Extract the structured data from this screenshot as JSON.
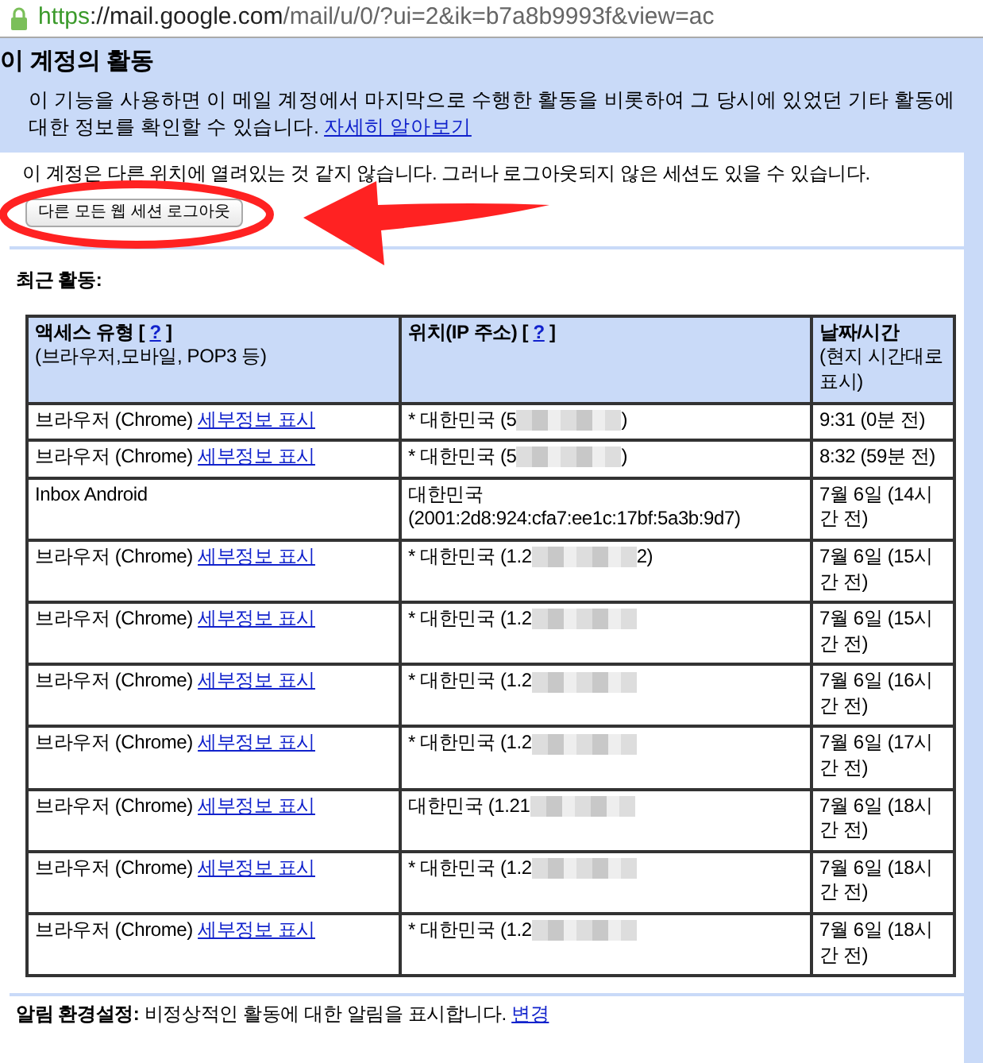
{
  "address_bar": {
    "scheme": "https",
    "host": "://mail.google.com",
    "path": "/mail/u/0/?ui=2&ik=b7a8b9993f&view=ac"
  },
  "title": "이 계정의 활동",
  "description": "이 기능을 사용하면 이 메일 계정에서 마지막으로 수행한 활동을 비롯하여 그 당시에 있었던 기타 활동에 대한 정보를 확인할 수 있습니다.",
  "learn_more_link": "자세히 알아보기",
  "status_text": "이 계정은 다른 위치에 열려있는 것 같지 않습니다. 그러나 로그아웃되지 않은 세션도 있을 수 있습니다.",
  "logout_button": "다른 모든 웹 세션 로그아웃",
  "recent_label": "최근 활동:",
  "table": {
    "columns": [
      {
        "title": "액세스 유형",
        "help_open": "[",
        "help": "?",
        "help_close": "]",
        "subtitle": "(브라우저,모바일, POP3 등)"
      },
      {
        "title": "위치(IP 주소)",
        "help_open": "[",
        "help": "?",
        "help_close": "]"
      },
      {
        "title": "날짜/시간",
        "subtitle": "(현지 시간대로 표시)"
      }
    ],
    "rows": [
      {
        "access": "브라우저 (Chrome)",
        "details_link": "세부정보 표시",
        "location": "* 대한민국 (5",
        "location_end": ")",
        "redacted": true,
        "time": "9:31 (0분 전)"
      },
      {
        "access": "브라우저 (Chrome)",
        "details_link": "세부정보 표시",
        "location": "* 대한민국 (5",
        "location_end": ")",
        "redacted": true,
        "time": "8:32 (59분 전)"
      },
      {
        "access": "Inbox Android",
        "location": "대한민국 (2001:2d8:924:cfa7:ee1c:17bf:5a3b:9d7)",
        "redacted": false,
        "time": "7월 6일 (14시간 전)"
      },
      {
        "access": "브라우저 (Chrome)",
        "details_link": "세부정보 표시",
        "location": "* 대한민국 (1.2",
        "location_end": "2)",
        "redacted": true,
        "time": "7월 6일 (15시간 전)"
      },
      {
        "access": "브라우저 (Chrome)",
        "details_link": "세부정보 표시",
        "location": "* 대한민국 (1.2",
        "redacted": true,
        "time": "7월 6일 (15시간 전)"
      },
      {
        "access": "브라우저 (Chrome)",
        "details_link": "세부정보 표시",
        "location": "* 대한민국 (1.2",
        "redacted": true,
        "time": "7월 6일 (16시간 전)"
      },
      {
        "access": "브라우저 (Chrome)",
        "details_link": "세부정보 표시",
        "location": "* 대한민국 (1.2",
        "redacted": true,
        "time": "7월 6일 (17시간 전)"
      },
      {
        "access": "브라우저 (Chrome)",
        "details_link": "세부정보 표시",
        "location": "대한민국 (1.21",
        "redacted": true,
        "time": "7월 6일 (18시간 전)"
      },
      {
        "access": "브라우저 (Chrome)",
        "details_link": "세부정보 표시",
        "location": "* 대한민국 (1.2",
        "redacted": true,
        "time": "7월 6일 (18시간 전)"
      },
      {
        "access": "브라우저 (Chrome)",
        "details_link": "세부정보 표시",
        "location": "* 대한민국 (1.2",
        "redacted": true,
        "time": "7월 6일 (18시간 전)"
      }
    ]
  },
  "alert_settings": {
    "label": "알림 환경설정:",
    "text": "비정상적인 활동에 대한 알림을 표시합니다.",
    "link": "변경"
  }
}
